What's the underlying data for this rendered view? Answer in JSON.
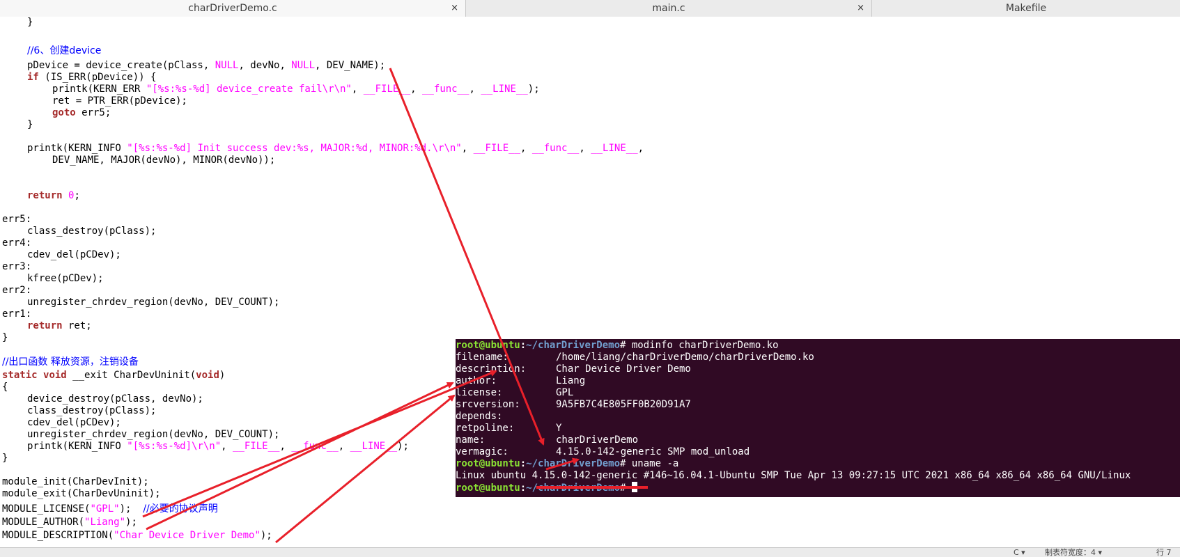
{
  "tabs": [
    {
      "label": "charDriverDemo.c",
      "close": "×"
    },
    {
      "label": "main.c",
      "close": "×"
    },
    {
      "label": "Makefile",
      "close": ""
    }
  ],
  "code": {
    "l1": "}",
    "l2": "//6、创建device",
    "l3a": "pDevice = device_create(pClass, ",
    "l3n1": "NULL",
    "l3b": ", devNo, ",
    "l3n2": "NULL",
    "l3c": ", DEV_NAME);",
    "l4kw": "if",
    "l4": " (IS_ERR(pDevice)) {",
    "l5a": "printk(KERN_ERR ",
    "l5s": "\"[%s:%s-%d] device_create fail\\r\\n\"",
    "l5b": ", ",
    "l5m1": "__FILE__",
    "l5c": ", ",
    "l5m2": "__func__",
    "l5d": ", ",
    "l5m3": "__LINE__",
    "l5e": ");",
    "l6": "ret = PTR_ERR(pDevice);",
    "l7kw": "goto",
    "l7": " err5;",
    "l8": "}",
    "l9a": "printk(KERN_INFO ",
    "l9s": "\"[%s:%s-%d] Init success dev:%s, MAJOR:%d, MINOR:%d.\\r\\n\"",
    "l9b": ", ",
    "l9m1": "__FILE__",
    "l9c": ", ",
    "l9m2": "__func__",
    "l9d": ", ",
    "l9m3": "__LINE__",
    "l9e": ",",
    "l10": "DEV_NAME, MAJOR(devNo), MINOR(devNo));",
    "l11kw": "return",
    "l11n": "0",
    "l11e": ";",
    "l12": "err5:",
    "l13": "class_destroy(pClass);",
    "l14": "err4:",
    "l15": "cdev_del(pCDev);",
    "l16": "err3:",
    "l17": "kfree(pCDev);",
    "l18": "err2:",
    "l19": "unregister_chrdev_region(devNo, DEV_COUNT);",
    "l20": "err1:",
    "l21kw": "return",
    "l21": " ret;",
    "l22": "}",
    "l23": "//出口函数 释放资源，注销设备",
    "l24kw1": "static",
    "l24kw2": "void",
    "l24a": " __exit CharDevUninit(",
    "l24kw3": "void",
    "l24b": ")",
    "l25": "{",
    "l26": "device_destroy(pClass, devNo);",
    "l27": "class_destroy(pClass);",
    "l28": "cdev_del(pCDev);",
    "l29": "unregister_chrdev_region(devNo, DEV_COUNT);",
    "l30a": "printk(KERN_INFO ",
    "l30s": "\"[%s:%s-%d]\\r\\n\"",
    "l30b": ", ",
    "l30m1": "__FILE__",
    "l30c": ", ",
    "l30m2": "__func__",
    "l30d": ", ",
    "l30m3": "__LINE__",
    "l30e": ");",
    "l31": "}",
    "l32": "module_init(CharDevInit);",
    "l33": "module_exit(CharDevUninit);",
    "l34a": "MODULE_LICENSE(",
    "l34s": "\"GPL\"",
    "l34b": ");  ",
    "l34c": "//必要的协议声明",
    "l35a": "MODULE_AUTHOR(",
    "l35s": "\"Liang\"",
    "l35b": ");",
    "l36a": "MODULE_DESCRIPTION(",
    "l36s": "\"Char Device Driver Demo\"",
    "l36b": ");"
  },
  "terminal": {
    "user": "root@ubuntu",
    "sep": ":",
    "path": "~/charDriverDemo",
    "hash": "# ",
    "cmd1": "modinfo charDriverDemo.ko",
    "rows": [
      {
        "key": "filename:",
        "val": "/home/liang/charDriverDemo/charDriverDemo.ko"
      },
      {
        "key": "description:",
        "val": "Char Device Driver Demo"
      },
      {
        "key": "author:",
        "val": "Liang"
      },
      {
        "key": "license:",
        "val": "GPL"
      },
      {
        "key": "srcversion:",
        "val": "9A5FB7C4E805FF0B20D91A7"
      },
      {
        "key": "depends:",
        "val": ""
      },
      {
        "key": "retpoline:",
        "val": "Y"
      },
      {
        "key": "name:",
        "val": "charDriverDemo"
      },
      {
        "key": "vermagic:",
        "val": "4.15.0-142-generic SMP mod_unload"
      }
    ],
    "cmd2": "uname -a",
    "uname_out": "Linux ubuntu 4.15.0-142-generic #146~16.04.1-Ubuntu SMP Tue Apr 13 09:27:15 UTC 2021 x86_64 x86_64 x86_64 GNU/Linux"
  },
  "status": {
    "lang": "C ▾",
    "tab": "制表符宽度：4 ▾",
    "pos": "行 7"
  },
  "colors": {
    "arrow": "#e8202a",
    "terminal_bg": "#300a24"
  }
}
